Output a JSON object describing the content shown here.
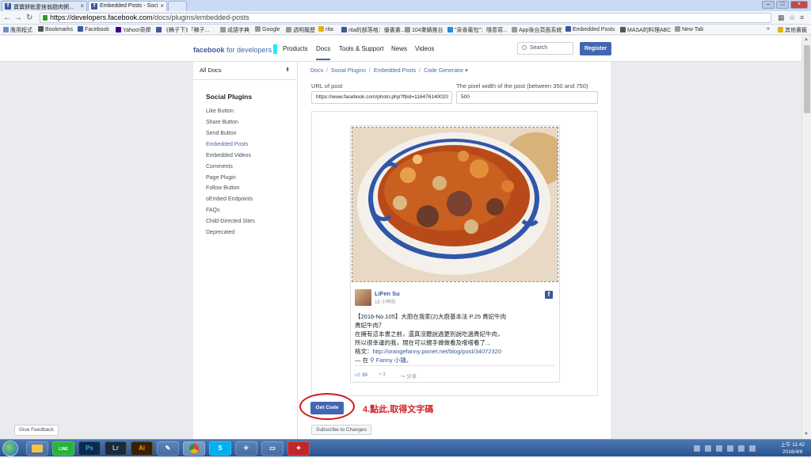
{
  "browser": {
    "tabs": [
      {
        "label": "寶寶餅乾愛捨翁甜肉粥...",
        "active": false
      },
      {
        "label": "Embedded Posts - Soci",
        "active": true
      },
      {
        "label": "",
        "active": false
      }
    ],
    "url_host": "https://developers.facebook.com",
    "url_path": "/docs/plugins/embedded-posts",
    "bookmarks": [
      "應用程式",
      "Bookmarks",
      "Facebook",
      "Yahoo!奇摩",
      "《稿子下》「稿子...",
      "成語字典",
      "Google",
      "透明履歷",
      "rita",
      "rita的部落格：優書書...",
      "104業績推台",
      "\"采香薰包\"：隨意寫...",
      "App後台頁面系統",
      "Embedded Posts",
      "MASA的料理ABC",
      "New Tab"
    ],
    "other_bookmarks": "其他書籤"
  },
  "header": {
    "logo_bold": "facebook",
    "logo_suffix": "for developers",
    "nav": [
      "Products",
      "Docs",
      "Tools & Support",
      "News",
      "Videos"
    ],
    "active_nav": "Docs",
    "search_placeholder": "Search",
    "register_label": "Register"
  },
  "sidebar": {
    "dropdown": "All Docs",
    "section_title": "Social Plugins",
    "items": [
      "Like Button",
      "Share Button",
      "Send Button",
      "Embedded Posts",
      "Embedded Videos",
      "Comments",
      "Page Plugin",
      "Follow Button",
      "oEmbed Endpoints",
      "FAQs",
      "Child-Directed Sites",
      "Deprecated"
    ],
    "active_item": "Embedded Posts"
  },
  "main": {
    "breadcrumb": [
      "Docs",
      "Social Plugins",
      "Embedded Posts",
      "Code Generator ▾"
    ],
    "url_label": "URL of post",
    "url_value": "https://www.facebook.com/photo.php?fbid=116476140020",
    "width_label": "The pixel width of the post (between 350 and 750)",
    "width_value": "500",
    "get_code_label": "Get Code",
    "annotation": "4.點此,取得文字碼",
    "subscribe_label": "Subscribe to Changes",
    "feedback_label": "Give Feedback"
  },
  "post": {
    "author": "LiFen Su",
    "time": "18 小時前",
    "lines": [
      "【2016-No.105】大廚在我家(2)大廚基本法 P.25 貴妃牛肉",
      "貴妃牛肉？",
      "在擁有這本書之前，還真沒聽說過更別說吃過貴妃牛肉，",
      "所以很幸運的我，現在可以親手做做看及嚐嚐看了..."
    ],
    "article_label": "格文：",
    "article_link": "http://orangefanny.pixnet.net/blog/post/34072320",
    "mention_prefix": "— 在",
    "mention_name": "Fanny 小鍾。",
    "likes": "39",
    "comments": "3",
    "share": "分享"
  },
  "taskbar": {
    "apps": [
      "",
      "LINE",
      "Ps",
      "Lr",
      "Ai",
      "",
      "",
      "S",
      "",
      "",
      ""
    ],
    "time": "上午 11:42",
    "date": "2016/4/8"
  }
}
